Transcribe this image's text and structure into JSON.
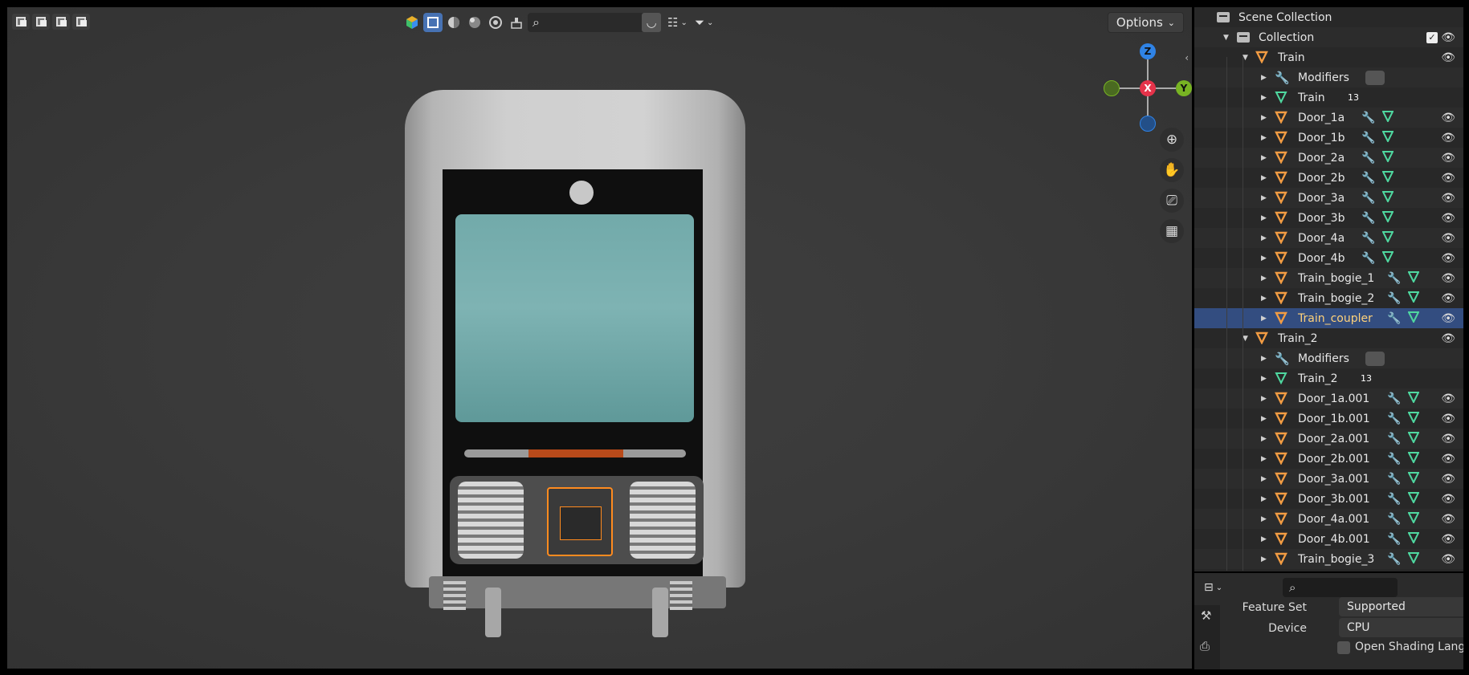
{
  "viewport_header": {
    "options_label": "Options",
    "search_placeholder": ""
  },
  "gizmo": {
    "z": "Z",
    "x": "X",
    "y": "Y"
  },
  "outliner": {
    "scene_collection": "Scene Collection",
    "collection": "Collection",
    "rows": [
      {
        "label": "Train",
        "kind": "object-parent"
      },
      {
        "label": "Modifiers",
        "kind": "modifiers"
      },
      {
        "label": "Train",
        "kind": "mesh-data",
        "badge": "13"
      },
      {
        "label": "Door_1a",
        "kind": "object"
      },
      {
        "label": "Door_1b",
        "kind": "object"
      },
      {
        "label": "Door_2a",
        "kind": "object"
      },
      {
        "label": "Door_2b",
        "kind": "object"
      },
      {
        "label": "Door_3a",
        "kind": "object"
      },
      {
        "label": "Door_3b",
        "kind": "object"
      },
      {
        "label": "Door_4a",
        "kind": "object"
      },
      {
        "label": "Door_4b",
        "kind": "object"
      },
      {
        "label": "Train_bogie_1",
        "kind": "object"
      },
      {
        "label": "Train_bogie_2",
        "kind": "object"
      },
      {
        "label": "Train_coupler",
        "kind": "object",
        "selected": true
      },
      {
        "label": "Train_2",
        "kind": "object-parent"
      },
      {
        "label": "Modifiers",
        "kind": "modifiers"
      },
      {
        "label": "Train_2",
        "kind": "mesh-data",
        "badge": "13"
      },
      {
        "label": "Door_1a.001",
        "kind": "object"
      },
      {
        "label": "Door_1b.001",
        "kind": "object"
      },
      {
        "label": "Door_2a.001",
        "kind": "object"
      },
      {
        "label": "Door_2b.001",
        "kind": "object"
      },
      {
        "label": "Door_3a.001",
        "kind": "object"
      },
      {
        "label": "Door_3b.001",
        "kind": "object"
      },
      {
        "label": "Door_4a.001",
        "kind": "object"
      },
      {
        "label": "Door_4b.001",
        "kind": "object"
      },
      {
        "label": "Train_bogie_3",
        "kind": "object"
      }
    ]
  },
  "properties": {
    "feature_set_label": "Feature Set",
    "feature_set_value": "Supported",
    "device_label": "Device",
    "device_value": "CPU",
    "osl_label": "Open Shading Langua"
  },
  "colors": {
    "selected_row": "#334d80",
    "accent_blue": "#4772b3",
    "outline_orange": "#ff8b1f",
    "axis_x": "#e5334a",
    "axis_y": "#78b423",
    "axis_z": "#2f83e6"
  }
}
